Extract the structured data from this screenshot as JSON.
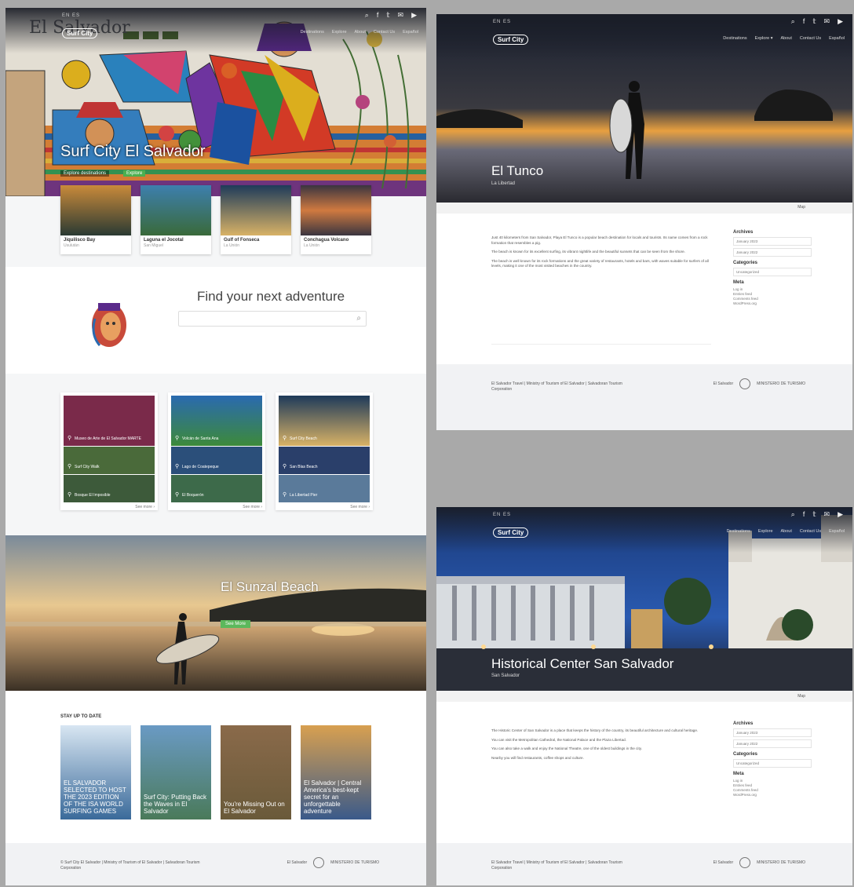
{
  "left": {
    "topbar": {
      "lang": "EN  ES",
      "logo": "Surf City",
      "social": [
        "⌕",
        "f",
        "𝕥",
        "✉",
        "▶"
      ],
      "nav": [
        "Destinations",
        "Explore",
        "About",
        "Contact Us",
        "Español"
      ]
    },
    "hero": {
      "title": "Surf City El Salvador",
      "subtitle": "Explore destinations",
      "button": "Explore"
    },
    "cards": [
      {
        "title": "Jiquilisco Bay",
        "sub": "Usulután",
        "color1": "#2a3a33",
        "color2": "#c98a3a"
      },
      {
        "title": "Laguna el Jocotal",
        "sub": "San Miguel",
        "color1": "#3d7fae",
        "color2": "#3a6a3a"
      },
      {
        "title": "Gulf of Fonseca",
        "sub": "La Unión",
        "color1": "#1e3b5a",
        "color2": "#d8b266"
      },
      {
        "title": "Conchagua Volcano",
        "sub": "La Unión",
        "color1": "#3a3540",
        "color2": "#d07a40"
      }
    ],
    "find": {
      "title": "Find your next adventure",
      "placeholder": ""
    },
    "tiles": [
      {
        "rows": [
          "Museo de Arte de El Salvador MARTE",
          "Surf City Walk",
          "Bosque El Imposible"
        ],
        "colors": [
          "#7a2a4a",
          "#4a6a3a",
          "#3d5a3a"
        ],
        "more": "See more ›"
      },
      {
        "rows": [
          "Volcán de Santa Ana",
          "Lago de Coatepeque",
          "El Boquerón"
        ],
        "colors": [
          "#3d8a3a",
          "#2b4f7a",
          "#3d6a4a"
        ],
        "more": "See more ›"
      },
      {
        "rows": [
          "Surf City Beach",
          "San Blas Beach",
          "La Libertad Pier"
        ],
        "colors": [
          "#1e3a5a",
          "#2a3f6a",
          "#5a7a9a"
        ],
        "more": "See more ›"
      }
    ],
    "sunzal": {
      "title": "El Sunzal Beach",
      "button": "See More"
    },
    "stories_heading": "STAY UP TO DATE",
    "stories": [
      {
        "text": "EL SALVADOR SELECTED TO HOST THE 2023 EDITION OF THE ISA WORLD SURFING GAMES",
        "color1": "#3a6a9a",
        "color2": "#d8e6f2"
      },
      {
        "text": "Surf City: Putting Back the Waves in El Salvador",
        "color1": "#4a7a5a",
        "color2": "#6a9ac4"
      },
      {
        "text": "You're Missing Out on El Salvador",
        "color1": "#6a5a3a",
        "color2": "#8a6a4a"
      },
      {
        "text": "El Salvador | Central America's best-kept secret for an unforgettable adventure",
        "color1": "#3a5a8a",
        "color2": "#d8a050"
      }
    ],
    "footer": {
      "text": "© Surf City El Salvador | Ministry of Tourism of El Salvador | Salvadoran Tourism Corporation",
      "logo1": "El Salvador",
      "logo2": "MINISTERIO DE TURISMO"
    }
  },
  "right_top": {
    "topbar": {
      "lang": "EN  ES",
      "logo": "Surf City",
      "social": [
        "⌕",
        "f",
        "𝕥",
        "✉",
        "▶"
      ],
      "nav": [
        "Destinations",
        "Explore ▾",
        "About",
        "Contact Us",
        "Español"
      ]
    },
    "title": "El Tunco",
    "location": "La Libertad",
    "map": "Map",
    "paragraphs": [
      "Just 40 kilometers from San Salvador, Playa El Tunco is a popular beach destination for locals and tourists. Its name comes from a rock formation that resembles a pig.",
      "The beach is known for its excellent surfing, its vibrant nightlife and the beautiful sunsets that can be seen from the shore.",
      "The beach is well known for its rock formations and the great variety of restaurants, hotels and bars, with waves suitable for surfers of all levels, making it one of the most visited beaches in the country."
    ],
    "sidebar": {
      "archives_h": "Archives",
      "archives": [
        "January 2023",
        "January 2022"
      ],
      "categories_h": "Categories",
      "categories": [
        "Uncategorized"
      ],
      "meta_h": "Meta",
      "meta": [
        "Log in",
        "Entries feed",
        "Comments feed",
        "WordPress.org"
      ]
    },
    "footer": {
      "text": "El Salvador Travel | Ministry of Tourism of El Salvador | Salvadoran Tourism Corporation",
      "logo1": "El Salvador",
      "logo2": "MINISTERIO DE TURISMO"
    }
  },
  "right_bot": {
    "topbar": {
      "lang": "EN  ES",
      "logo": "Surf City",
      "social": [
        "⌕",
        "f",
        "𝕥",
        "✉",
        "▶"
      ],
      "nav": [
        "Destinations",
        "Explore",
        "About",
        "Contact Us",
        "Español"
      ]
    },
    "title": "Historical Center San Salvador",
    "location": "San Salvador",
    "map": "Map",
    "paragraphs": [
      "The Historic Center of San Salvador is a place that keeps the history of the country, its beautiful architecture and cultural heritage.",
      "You can visit the Metropolitan Cathedral, the National Palace and the Plaza Libertad.",
      "You can also take a walk and enjoy the National Theatre, one of the oldest buildings in the city.",
      "Nearby you will find restaurants, coffee shops and culture."
    ],
    "sidebar": {
      "archives_h": "Archives",
      "archives": [
        "January 2023",
        "January 2022"
      ],
      "categories_h": "Categories",
      "categories": [
        "Uncategorized"
      ],
      "meta_h": "Meta",
      "meta": [
        "Log in",
        "Entries feed",
        "Comments feed",
        "WordPress.org"
      ]
    },
    "footer": {
      "text": "El Salvador Travel | Ministry of Tourism of El Salvador | Salvadoran Tourism Corporation",
      "logo1": "El Salvador",
      "logo2": "MINISTERIO DE TURISMO"
    }
  }
}
